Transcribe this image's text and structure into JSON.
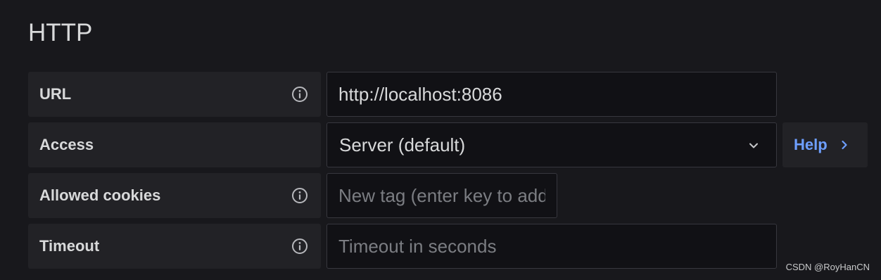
{
  "section": {
    "title": "HTTP"
  },
  "fields": {
    "url": {
      "label": "URL",
      "value": "http://localhost:8086",
      "icon": "info-icon"
    },
    "access": {
      "label": "Access",
      "selected": "Server (default)",
      "icon": "chevron-down-icon",
      "help_label": "Help",
      "help_icon": "chevron-right-icon"
    },
    "allowed_cookies": {
      "label": "Allowed cookies",
      "placeholder": "New tag (enter key to add)",
      "icon": "info-icon"
    },
    "timeout": {
      "label": "Timeout",
      "placeholder": "Timeout in seconds",
      "icon": "info-icon"
    }
  },
  "colors": {
    "background": "#18181c",
    "label_background": "#222226",
    "input_background": "#111115",
    "input_border": "#37373e",
    "text": "#d8d9da",
    "placeholder": "#7b7d82",
    "link": "#6e9fff"
  },
  "watermark": {
    "text": "CSDN @RoyHanCN"
  }
}
